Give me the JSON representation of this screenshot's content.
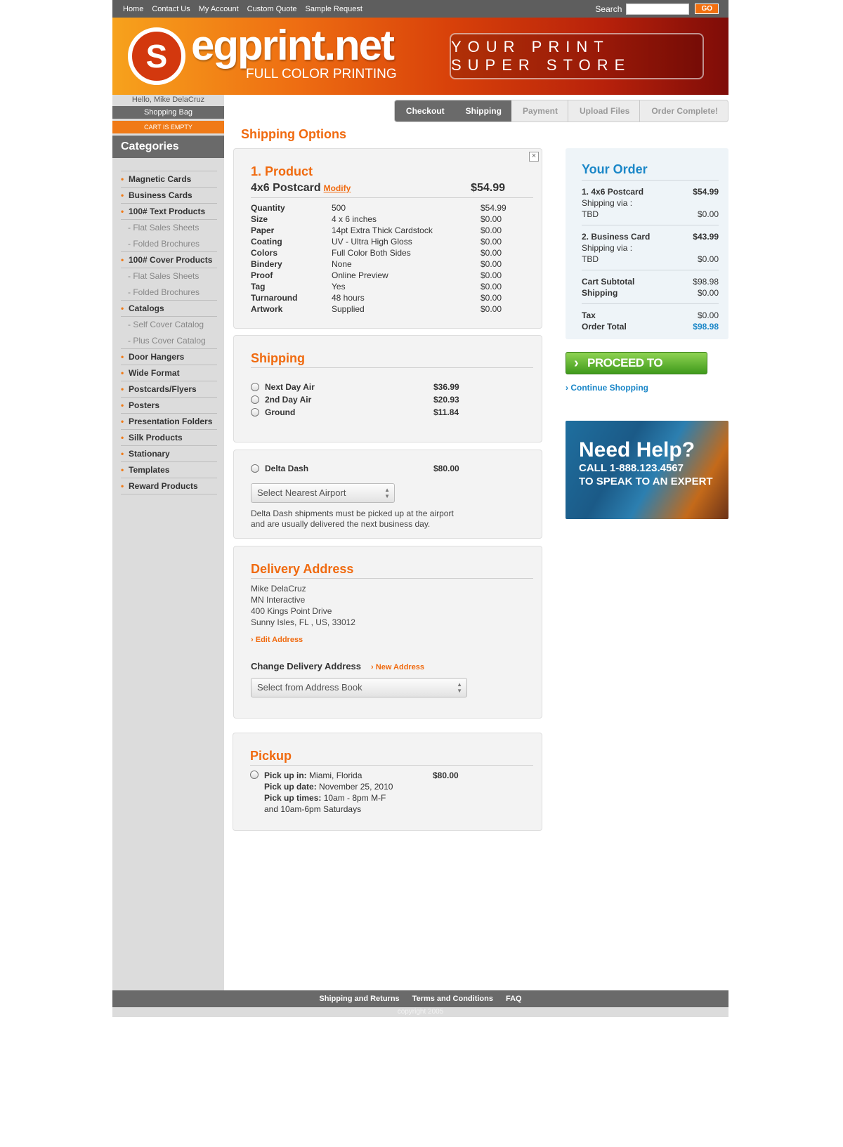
{
  "nav": {
    "links": [
      "Home",
      "Contact Us",
      "My Account",
      "Custom Quote",
      "Sample Request"
    ],
    "search_label": "Search",
    "go_label": "GO"
  },
  "banner": {
    "logo_text": "egprint.net",
    "logo_sub": "FULL COLOR PRINTING",
    "tagline": "YOUR PRINT SUPER STORE"
  },
  "sidebar": {
    "hello": "Hello, Mike DelaCruz",
    "bag": "Shopping Bag",
    "empty": "CART IS EMPTY",
    "categories_title": "Categories",
    "items": [
      {
        "label": "Magnetic Cards",
        "sub": false
      },
      {
        "label": "Business Cards",
        "sub": false
      },
      {
        "label": "100# Text Products",
        "sub": false
      },
      {
        "label": "- Flat Sales Sheets",
        "sub": true
      },
      {
        "label": "- Folded Brochures",
        "sub": true
      },
      {
        "label": "100# Cover Products",
        "sub": false
      },
      {
        "label": "- Flat Sales Sheets",
        "sub": true
      },
      {
        "label": "- Folded Brochures",
        "sub": true
      },
      {
        "label": "Catalogs",
        "sub": false
      },
      {
        "label": "- Self Cover Catalog",
        "sub": true
      },
      {
        "label": "- Plus Cover Catalog",
        "sub": true
      },
      {
        "label": "Door Hangers",
        "sub": false
      },
      {
        "label": "Wide Format",
        "sub": false
      },
      {
        "label": "Postcards/Flyers",
        "sub": false
      },
      {
        "label": "Posters",
        "sub": false
      },
      {
        "label": "Presentation Folders",
        "sub": false
      },
      {
        "label": "Silk Products",
        "sub": false
      },
      {
        "label": "Stationary",
        "sub": false
      },
      {
        "label": "Templates",
        "sub": false
      },
      {
        "label": "Reward Products",
        "sub": false
      }
    ]
  },
  "steps": [
    {
      "label": "Checkout",
      "active": true
    },
    {
      "label": "Shipping",
      "active": true
    },
    {
      "label": "Payment",
      "active": false
    },
    {
      "label": "Upload Files",
      "active": false
    },
    {
      "label": "Order Complete!",
      "active": false
    }
  ],
  "page_title": "Shipping Options",
  "product": {
    "heading": "1. Product",
    "name": "4x6 Postcard",
    "modify": "Modify",
    "price": "$54.99",
    "specs": [
      {
        "k": "Quantity",
        "v": "500",
        "p": "$54.99"
      },
      {
        "k": "Size",
        "v": "4 x 6 inches",
        "p": "$0.00"
      },
      {
        "k": "Paper",
        "v": "14pt Extra Thick Cardstock",
        "p": "$0.00"
      },
      {
        "k": "Coating",
        "v": "UV - Ultra High Gloss",
        "p": "$0.00"
      },
      {
        "k": "Colors",
        "v": "Full Color Both Sides",
        "p": "$0.00"
      },
      {
        "k": "Bindery",
        "v": "None",
        "p": "$0.00"
      },
      {
        "k": "Proof",
        "v": "Online Preview",
        "p": "$0.00"
      },
      {
        "k": "Tag",
        "v": "Yes",
        "p": "$0.00"
      },
      {
        "k": "Turnaround",
        "v": "48 hours",
        "p": "$0.00"
      },
      {
        "k": "Artwork",
        "v": "Supplied",
        "p": "$0.00"
      }
    ]
  },
  "shipping": {
    "heading": "Shipping",
    "options": [
      {
        "label": "Next Day Air",
        "price": "$36.99"
      },
      {
        "label": "2nd Day Air",
        "price": "$20.93"
      },
      {
        "label": "Ground",
        "price": "$11.84"
      }
    ]
  },
  "delta": {
    "label": "Delta Dash",
    "price": "$80.00",
    "select": "Select Nearest Airport",
    "note1": "Delta Dash shipments must be picked up at the airport",
    "note2": "and are usually delivered the next business day."
  },
  "delivery": {
    "heading": "Delivery Address",
    "lines": [
      "Mike DelaCruz",
      "MN Interactive",
      "400 Kings Point Drive",
      "Sunny Isles, FL , US, 33012"
    ],
    "edit": "Edit Address",
    "change_label": "Change Delivery Address",
    "new_address": "New Address",
    "select": "Select from Address Book"
  },
  "pickup": {
    "heading": "Pickup",
    "price": "$80.00",
    "in_label": "Pick up in:",
    "in_value": "Miami, Florida",
    "date_label": "Pick up date:",
    "date_value": "November 25, 2010",
    "times_label": "Pick up times:",
    "times_value": "10am - 8pm M-F",
    "times_extra": "and 10am-6pm Saturdays"
  },
  "order": {
    "heading": "Your Order",
    "items": [
      {
        "name": "1. 4x6 Postcard",
        "price": "$54.99",
        "via": "Shipping via :",
        "method": "TBD",
        "ship_price": "$0.00"
      },
      {
        "name": "2.  Business Card",
        "price": "$43.99",
        "via": "Shipping via :",
        "method": "TBD",
        "ship_price": "$0.00"
      }
    ],
    "subtotal_label": "Cart Subtotal",
    "subtotal": "$98.98",
    "shipping_label": "Shipping",
    "shipping": "$0.00",
    "tax_label": "Tax",
    "tax": "$0.00",
    "total_label": "Order Total",
    "total": "$98.98"
  },
  "checkout_button": "PROCEED TO CHECKOUT",
  "continue_link": "Continue Shopping",
  "help": {
    "title": "Need Help?",
    "line1": "CALL 1-888.123.4567",
    "line2": "TO SPEAK TO AN EXPERT"
  },
  "footer": {
    "links": [
      "Shipping and Returns",
      "Terms and Conditions",
      "FAQ"
    ],
    "copyright": "copyright 2005"
  },
  "colors": {
    "accent": "#f06a0f",
    "blue": "#1b87c8",
    "green": "#4fa825",
    "bar": "#6a6a6a"
  }
}
